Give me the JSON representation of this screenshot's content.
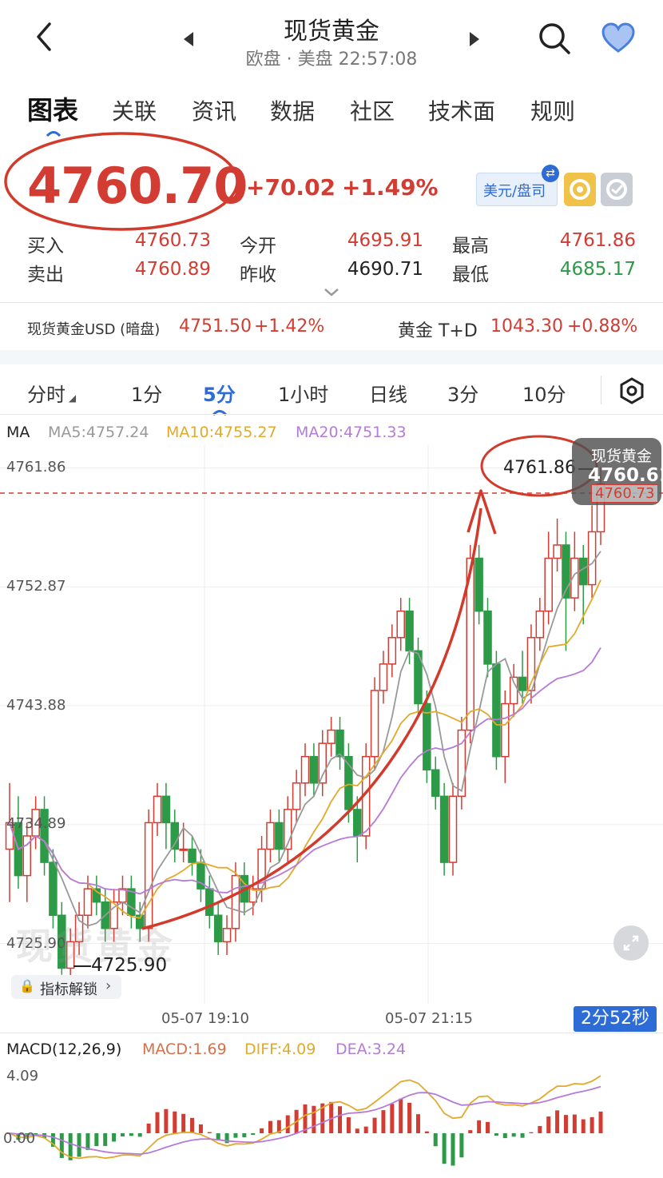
{
  "header": {
    "title": "现货黄金",
    "session": "欧盘 · 美盘 22:57:08"
  },
  "tabs": [
    "图表",
    "关联",
    "资讯",
    "数据",
    "社区",
    "技术面",
    "规则"
  ],
  "quote": {
    "price": "4760.70",
    "change": "+70.02",
    "change_pct": "+1.49%",
    "currency_btn": "美元/盘司",
    "rows": [
      {
        "label": "买入",
        "value": "4760.73",
        "color": "red"
      },
      {
        "label": "卖出",
        "value": "4760.89",
        "color": "red"
      },
      {
        "label": "今开",
        "value": "4695.91",
        "color": "red"
      },
      {
        "label": "昨收",
        "value": "4690.71",
        "color": "black"
      },
      {
        "label": "最高",
        "value": "4761.86",
        "color": "red"
      },
      {
        "label": "最低",
        "value": "4685.17",
        "color": "green"
      }
    ]
  },
  "related": {
    "left_name": "现货黄金USD (暗盘)",
    "left_price": "4751.50",
    "left_pct": "+1.42%",
    "right_name": "黄金 T+D",
    "right_price": "1043.30",
    "right_pct": "+0.88%"
  },
  "periods": [
    "分时",
    "1分",
    "5分",
    "1小时",
    "日线",
    "3分",
    "10分"
  ],
  "active_period": "5分",
  "ma": {
    "label": "MA",
    "ma5": "MA5:4757.24",
    "ma10": "MA10:4755.27",
    "ma20": "MA20:4751.33",
    "ma5_color": "#999999",
    "ma10_color": "#e2a92a",
    "ma20_color": "#b57bd6"
  },
  "yaxis": [
    "4761.86",
    "4752.87",
    "4743.88",
    "4734.89",
    "4725.90"
  ],
  "annot": {
    "high": "4761.86",
    "low": "4725.90",
    "tag_name": "现货黄金",
    "tag_price": "4760.61",
    "tag_sub": "4760.73",
    "watermark": "现货黄金",
    "unlock": "指标解锁"
  },
  "xaxis": [
    "05-07 19:10",
    "05-07 21:15"
  ],
  "countdown": "2分52秒",
  "macd": {
    "label": "MACD(12,26,9)",
    "macd": "MACD:1.69",
    "diff": "DIFF:4.09",
    "dea": "DEA:3.24",
    "top": "4.09",
    "zero": "0.00"
  },
  "colors": {
    "up": "#d33c32",
    "down": "#2c9a47",
    "accent": "#2d6bd6"
  },
  "chart_data": {
    "type": "candlestick",
    "ylim": [
      4725.9,
      4761.86
    ],
    "candles": [
      [
        4733,
        4735,
        4738,
        4729
      ],
      [
        4735,
        4731,
        4737,
        4730
      ],
      [
        4731,
        4734,
        4735,
        4729
      ],
      [
        4734,
        4736,
        4737,
        4733
      ],
      [
        4736,
        4732,
        4737,
        4731
      ],
      [
        4732,
        4728,
        4733,
        4727
      ],
      [
        4728,
        4724,
        4729,
        4723.5
      ],
      [
        4724,
        4726,
        4727,
        4723
      ],
      [
        4726,
        4728,
        4729,
        4725
      ],
      [
        4728,
        4730,
        4731,
        4727
      ],
      [
        4730,
        4729,
        4731,
        4728
      ],
      [
        4729,
        4727,
        4730,
        4726
      ],
      [
        4727,
        4729,
        4730,
        4726
      ],
      [
        4729,
        4730,
        4731,
        4728
      ],
      [
        4730,
        4728,
        4731,
        4727
      ],
      [
        4728,
        4727,
        4729,
        4726
      ],
      [
        4727,
        4735,
        4736,
        4726
      ],
      [
        4735,
        4737,
        4738,
        4734
      ],
      [
        4737,
        4735,
        4738,
        4733
      ],
      [
        4735,
        4733,
        4736,
        4732
      ],
      [
        4733,
        4733,
        4735,
        4732
      ],
      [
        4733,
        4732,
        4734,
        4731
      ],
      [
        4732,
        4730,
        4733,
        4729
      ],
      [
        4730,
        4728,
        4731,
        4727
      ],
      [
        4728,
        4726,
        4729,
        4725
      ],
      [
        4726,
        4727,
        4728,
        4725
      ],
      [
        4727,
        4731,
        4732,
        4726
      ],
      [
        4731,
        4729,
        4732,
        4728
      ],
      [
        4729,
        4730,
        4731,
        4728
      ],
      [
        4730,
        4733,
        4734,
        4729
      ],
      [
        4733,
        4735,
        4736,
        4732
      ],
      [
        4735,
        4733,
        4736,
        4732
      ],
      [
        4733,
        4736,
        4737,
        4732
      ],
      [
        4736,
        4738,
        4739,
        4735
      ],
      [
        4738,
        4740,
        4741,
        4737
      ],
      [
        4740,
        4738,
        4741,
        4737
      ],
      [
        4738,
        4741,
        4742,
        4737
      ],
      [
        4741,
        4742,
        4743,
        4740
      ],
      [
        4742,
        4740,
        4743,
        4739
      ],
      [
        4740,
        4736,
        4741,
        4735
      ],
      [
        4736,
        4734,
        4737,
        4732
      ],
      [
        4734,
        4740,
        4741,
        4733
      ],
      [
        4740,
        4745,
        4746,
        4739
      ],
      [
        4745,
        4747,
        4748,
        4744
      ],
      [
        4747,
        4749,
        4750,
        4746
      ],
      [
        4749,
        4751,
        4752,
        4748
      ],
      [
        4751,
        4748,
        4752,
        4747
      ],
      [
        4748,
        4744,
        4749,
        4743
      ],
      [
        4744,
        4739,
        4745,
        4738
      ],
      [
        4739,
        4737,
        4740,
        4736
      ],
      [
        4737,
        4732,
        4738,
        4731
      ],
      [
        4732,
        4737,
        4738,
        4731
      ],
      [
        4737,
        4742,
        4743,
        4736
      ],
      [
        4742,
        4755,
        4756,
        4741
      ],
      [
        4755,
        4751,
        4756,
        4750
      ],
      [
        4751,
        4747,
        4752,
        4746
      ],
      [
        4747,
        4740,
        4748,
        4739
      ],
      [
        4740,
        4744,
        4745,
        4738
      ],
      [
        4744,
        4746,
        4747,
        4743
      ],
      [
        4746,
        4745,
        4748,
        4744
      ],
      [
        4745,
        4749,
        4750,
        4744
      ],
      [
        4749,
        4751,
        4752,
        4748
      ],
      [
        4751,
        4755,
        4757,
        4750
      ],
      [
        4755,
        4756,
        4758,
        4754
      ],
      [
        4756,
        4752,
        4757,
        4748
      ],
      [
        4752,
        4755,
        4757,
        4751
      ],
      [
        4755,
        4753,
        4756,
        4750
      ],
      [
        4753,
        4757,
        4759,
        4752
      ],
      [
        4757,
        4760.6,
        4761.86,
        4756
      ]
    ]
  }
}
